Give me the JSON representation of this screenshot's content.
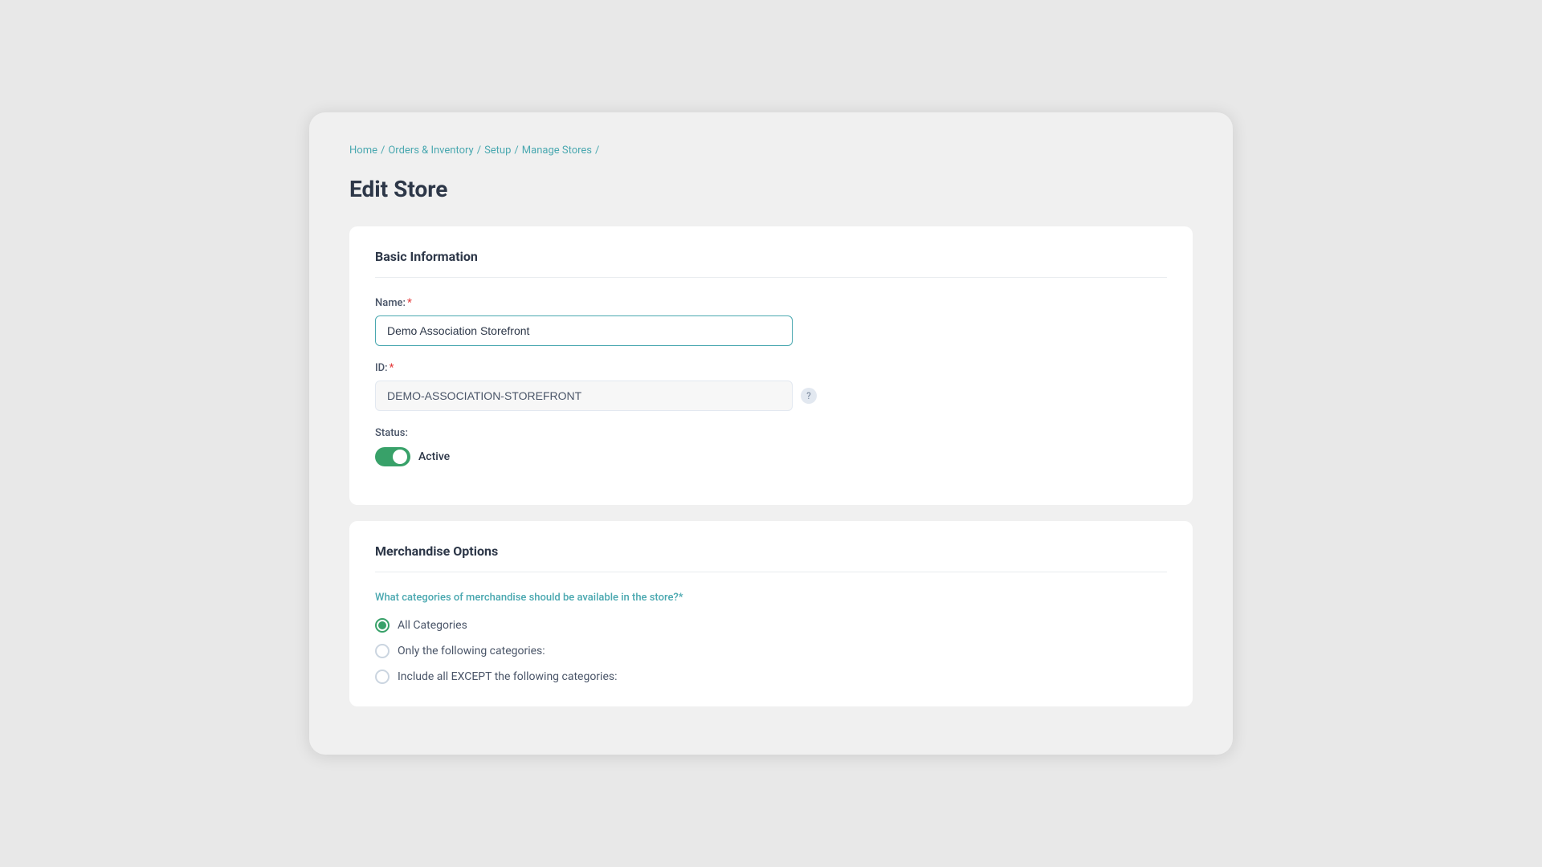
{
  "breadcrumb": {
    "home": "Home",
    "separator1": "/",
    "orders_inventory": "Orders & Inventory",
    "separator2": "/",
    "setup": "Setup",
    "separator3": "/",
    "manage_stores": "Manage Stores",
    "separator4": "/"
  },
  "page": {
    "title": "Edit Store"
  },
  "basic_information": {
    "section_title": "Basic Information",
    "name_label": "Name:",
    "name_required": "*",
    "name_value": "Demo Association Storefront",
    "id_label": "ID:",
    "id_required": "*",
    "id_value": "DEMO-ASSOCIATION-STOREFRONT",
    "status_label": "Status:",
    "status_text": "Active"
  },
  "merchandise_options": {
    "section_title": "Merchandise Options",
    "question": "What categories of merchandise should be available in the store?*",
    "options": [
      {
        "id": "all",
        "label": "All Categories",
        "selected": true
      },
      {
        "id": "only",
        "label": "Only the following categories:",
        "selected": false
      },
      {
        "id": "except",
        "label": "Include all EXCEPT the following categories:",
        "selected": false
      }
    ]
  },
  "icons": {
    "help": "?"
  }
}
